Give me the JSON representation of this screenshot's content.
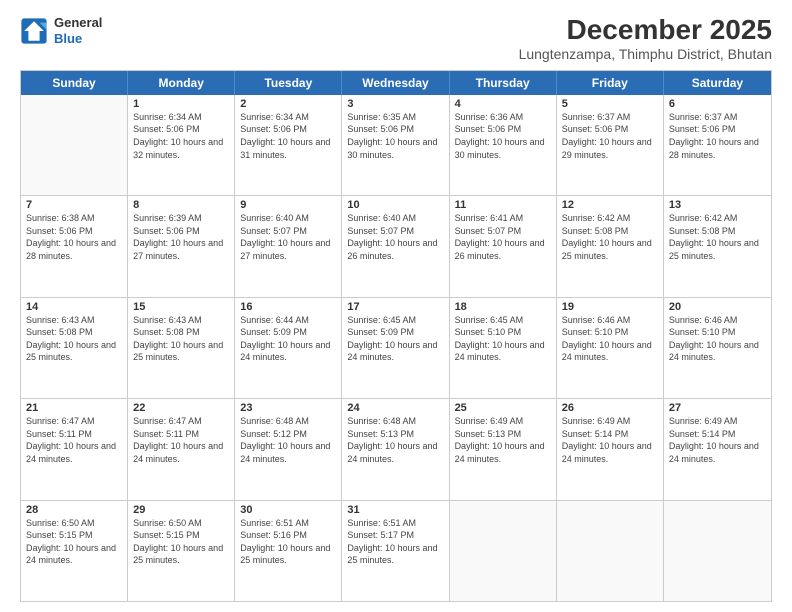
{
  "logo": {
    "line1": "General",
    "line2": "Blue"
  },
  "title": "December 2025",
  "subtitle": "Lungtenzampa, Thimphu District, Bhutan",
  "days_of_week": [
    "Sunday",
    "Monday",
    "Tuesday",
    "Wednesday",
    "Thursday",
    "Friday",
    "Saturday"
  ],
  "weeks": [
    [
      {
        "day": "",
        "empty": true
      },
      {
        "day": "1",
        "sunrise": "6:34 AM",
        "sunset": "5:06 PM",
        "daylight": "10 hours and 32 minutes."
      },
      {
        "day": "2",
        "sunrise": "6:34 AM",
        "sunset": "5:06 PM",
        "daylight": "10 hours and 31 minutes."
      },
      {
        "day": "3",
        "sunrise": "6:35 AM",
        "sunset": "5:06 PM",
        "daylight": "10 hours and 30 minutes."
      },
      {
        "day": "4",
        "sunrise": "6:36 AM",
        "sunset": "5:06 PM",
        "daylight": "10 hours and 30 minutes."
      },
      {
        "day": "5",
        "sunrise": "6:37 AM",
        "sunset": "5:06 PM",
        "daylight": "10 hours and 29 minutes."
      },
      {
        "day": "6",
        "sunrise": "6:37 AM",
        "sunset": "5:06 PM",
        "daylight": "10 hours and 28 minutes."
      }
    ],
    [
      {
        "day": "7",
        "sunrise": "6:38 AM",
        "sunset": "5:06 PM",
        "daylight": "10 hours and 28 minutes."
      },
      {
        "day": "8",
        "sunrise": "6:39 AM",
        "sunset": "5:06 PM",
        "daylight": "10 hours and 27 minutes."
      },
      {
        "day": "9",
        "sunrise": "6:40 AM",
        "sunset": "5:07 PM",
        "daylight": "10 hours and 27 minutes."
      },
      {
        "day": "10",
        "sunrise": "6:40 AM",
        "sunset": "5:07 PM",
        "daylight": "10 hours and 26 minutes."
      },
      {
        "day": "11",
        "sunrise": "6:41 AM",
        "sunset": "5:07 PM",
        "daylight": "10 hours and 26 minutes."
      },
      {
        "day": "12",
        "sunrise": "6:42 AM",
        "sunset": "5:08 PM",
        "daylight": "10 hours and 25 minutes."
      },
      {
        "day": "13",
        "sunrise": "6:42 AM",
        "sunset": "5:08 PM",
        "daylight": "10 hours and 25 minutes."
      }
    ],
    [
      {
        "day": "14",
        "sunrise": "6:43 AM",
        "sunset": "5:08 PM",
        "daylight": "10 hours and 25 minutes."
      },
      {
        "day": "15",
        "sunrise": "6:43 AM",
        "sunset": "5:08 PM",
        "daylight": "10 hours and 25 minutes."
      },
      {
        "day": "16",
        "sunrise": "6:44 AM",
        "sunset": "5:09 PM",
        "daylight": "10 hours and 24 minutes."
      },
      {
        "day": "17",
        "sunrise": "6:45 AM",
        "sunset": "5:09 PM",
        "daylight": "10 hours and 24 minutes."
      },
      {
        "day": "18",
        "sunrise": "6:45 AM",
        "sunset": "5:10 PM",
        "daylight": "10 hours and 24 minutes."
      },
      {
        "day": "19",
        "sunrise": "6:46 AM",
        "sunset": "5:10 PM",
        "daylight": "10 hours and 24 minutes."
      },
      {
        "day": "20",
        "sunrise": "6:46 AM",
        "sunset": "5:10 PM",
        "daylight": "10 hours and 24 minutes."
      }
    ],
    [
      {
        "day": "21",
        "sunrise": "6:47 AM",
        "sunset": "5:11 PM",
        "daylight": "10 hours and 24 minutes."
      },
      {
        "day": "22",
        "sunrise": "6:47 AM",
        "sunset": "5:11 PM",
        "daylight": "10 hours and 24 minutes."
      },
      {
        "day": "23",
        "sunrise": "6:48 AM",
        "sunset": "5:12 PM",
        "daylight": "10 hours and 24 minutes."
      },
      {
        "day": "24",
        "sunrise": "6:48 AM",
        "sunset": "5:13 PM",
        "daylight": "10 hours and 24 minutes."
      },
      {
        "day": "25",
        "sunrise": "6:49 AM",
        "sunset": "5:13 PM",
        "daylight": "10 hours and 24 minutes."
      },
      {
        "day": "26",
        "sunrise": "6:49 AM",
        "sunset": "5:14 PM",
        "daylight": "10 hours and 24 minutes."
      },
      {
        "day": "27",
        "sunrise": "6:49 AM",
        "sunset": "5:14 PM",
        "daylight": "10 hours and 24 minutes."
      }
    ],
    [
      {
        "day": "28",
        "sunrise": "6:50 AM",
        "sunset": "5:15 PM",
        "daylight": "10 hours and 24 minutes."
      },
      {
        "day": "29",
        "sunrise": "6:50 AM",
        "sunset": "5:15 PM",
        "daylight": "10 hours and 25 minutes."
      },
      {
        "day": "30",
        "sunrise": "6:51 AM",
        "sunset": "5:16 PM",
        "daylight": "10 hours and 25 minutes."
      },
      {
        "day": "31",
        "sunrise": "6:51 AM",
        "sunset": "5:17 PM",
        "daylight": "10 hours and 25 minutes."
      },
      {
        "day": "",
        "empty": true
      },
      {
        "day": "",
        "empty": true
      },
      {
        "day": "",
        "empty": true
      }
    ]
  ]
}
